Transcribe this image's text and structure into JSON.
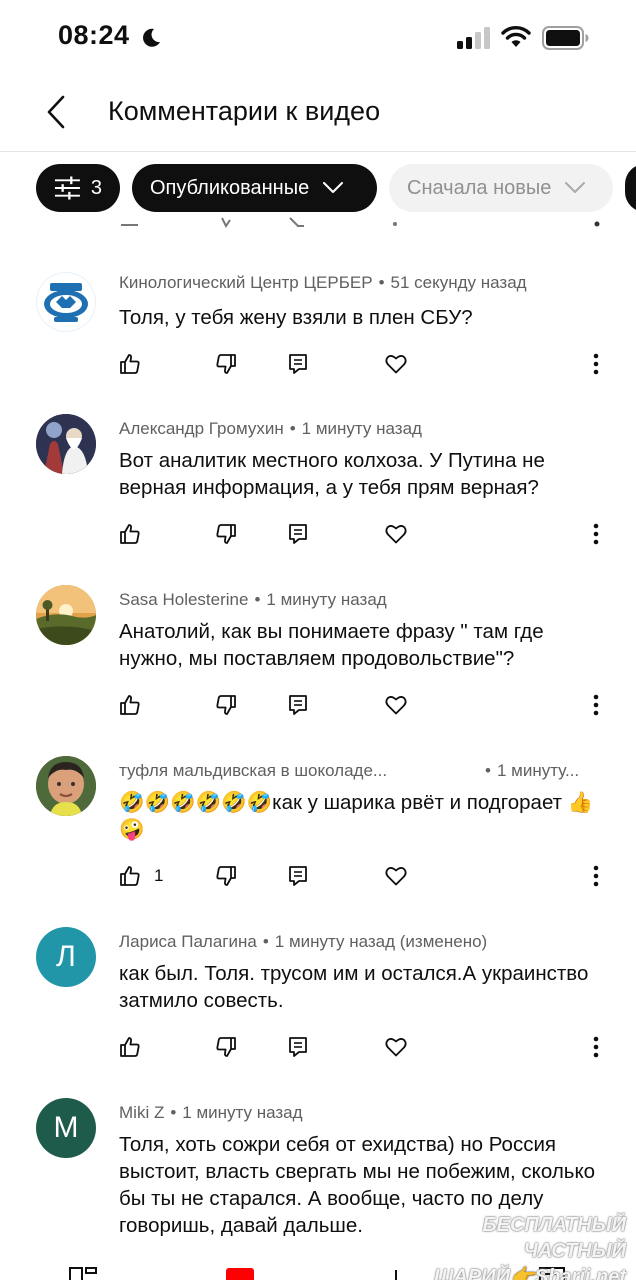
{
  "status_bar": {
    "time": "08:24"
  },
  "header": {
    "title": "Комментарии к видео"
  },
  "filters": {
    "count": "3",
    "published_label": "Опубликованные",
    "sort_label": "Сначала новые"
  },
  "comments": [
    {
      "author": "Кинологический Центр ЦЕРБЕР",
      "time": "51 секунду назад",
      "text": "Толя, у тебя жену взяли в плен СБУ?",
      "likes": "",
      "avatar": "logo",
      "avatar_color": "#1f6fb3"
    },
    {
      "author": "Александр Громухин",
      "time": "1 минуту назад",
      "text": "Вот аналитик местного колхоза. У Путина не верная информация, а у тебя прям верная?",
      "likes": "",
      "avatar": "photo",
      "avatar_color": "#3a3f5c"
    },
    {
      "author": "Sasa Holesterine",
      "time": "1 минуту назад",
      "text": "Анатолий, как вы понимаете фразу \" там где нужно, мы поставляем продовольствие\"?",
      "likes": "",
      "avatar": "photo",
      "avatar_color": "#b7843a"
    },
    {
      "author": "туфля мальдивская в шоколаде...",
      "time": "1 минуту...",
      "text": "🤣🤣🤣🤣🤣🤣как у шарика рвёт и подгорает 👍🤪",
      "likes": "1",
      "avatar": "photo",
      "avatar_color": "#6b4f3a"
    },
    {
      "author": "Лариса Палагина",
      "time": "1 минуту назад (изменено)",
      "text": "как был. Толя.  трусом им и остался.А украинство затмило совесть.",
      "likes": "",
      "avatar": "letter",
      "avatar_letter": "Л",
      "avatar_color": "#2196a8"
    },
    {
      "author": "Miki Z",
      "time": "1 минуту назад",
      "text": "Толя, хоть сожри себя от ехидства) но Россия выстоит, власть свергать мы не побежим, сколько бы ты не старался. А вообще, часто по делу говоришь, давай дальше.",
      "likes": "",
      "avatar": "letter",
      "avatar_letter": "M",
      "avatar_color": "#1e5b4b"
    }
  ],
  "watermark": {
    "line1": "БЕСПЛАТНЫЙ ЧАСТНЫЙ",
    "line2": "ШАРИЙ👉Sharij.net"
  }
}
